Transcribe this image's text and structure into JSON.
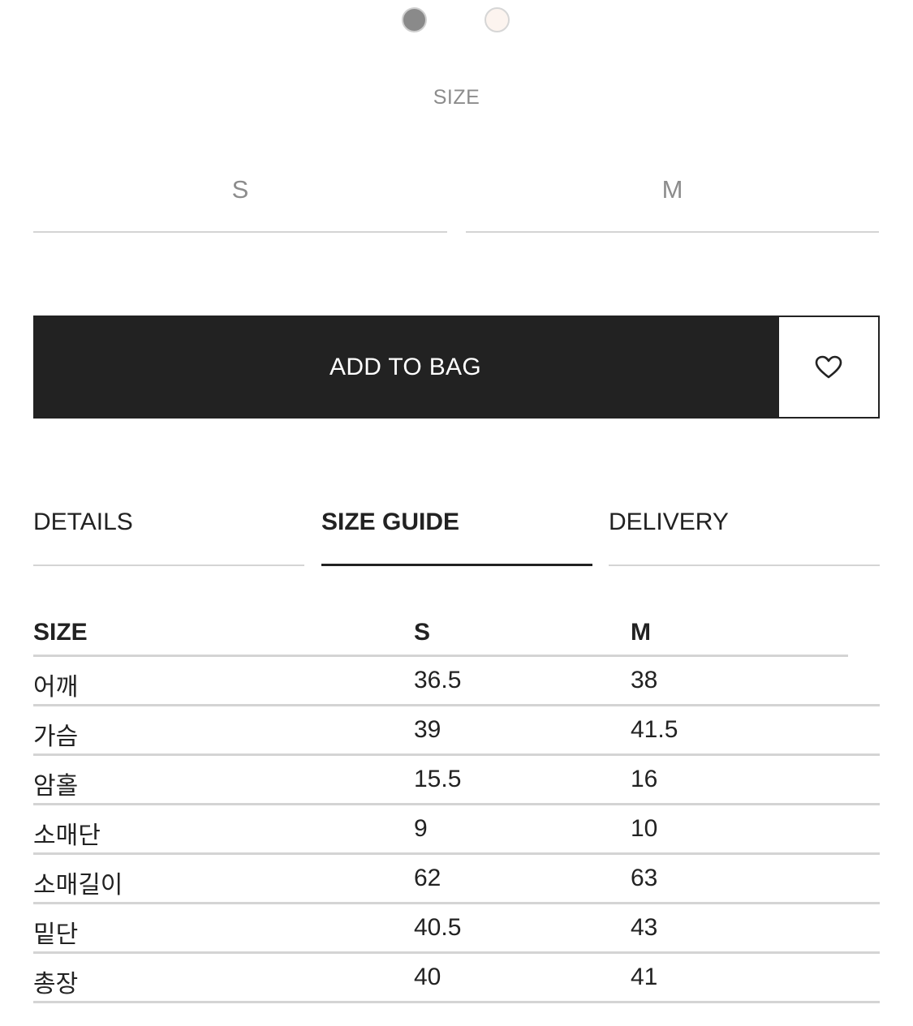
{
  "colors": {
    "swatches": [
      "#8a8a8a",
      "#fcf4ef"
    ],
    "button_bg": "#222222",
    "divider": "#d4d4d4"
  },
  "swatches": [
    {
      "name": "grey-swatch",
      "color": "#8a8a8a"
    },
    {
      "name": "ivory-swatch",
      "color": "#fcf4ef"
    }
  ],
  "size_selector": {
    "label": "SIZE",
    "options": [
      "S",
      "M"
    ]
  },
  "actions": {
    "add_to_bag": "ADD TO BAG",
    "wishlist_icon": "heart-icon"
  },
  "tabs": [
    {
      "label": "DETAILS",
      "active": false
    },
    {
      "label": "SIZE GUIDE",
      "active": true
    },
    {
      "label": "DELIVERY",
      "active": false
    }
  ],
  "size_table": {
    "headers": [
      "SIZE",
      "S",
      "M"
    ],
    "rows": [
      [
        "어깨",
        "36.5",
        "38"
      ],
      [
        "가슴",
        "39",
        "41.5"
      ],
      [
        "암홀",
        "15.5",
        "16"
      ],
      [
        "소매단",
        "9",
        "10"
      ],
      [
        "소매길이",
        "62",
        "63"
      ],
      [
        "밑단",
        "40.5",
        "43"
      ],
      [
        "총장",
        "40",
        "41"
      ]
    ]
  }
}
